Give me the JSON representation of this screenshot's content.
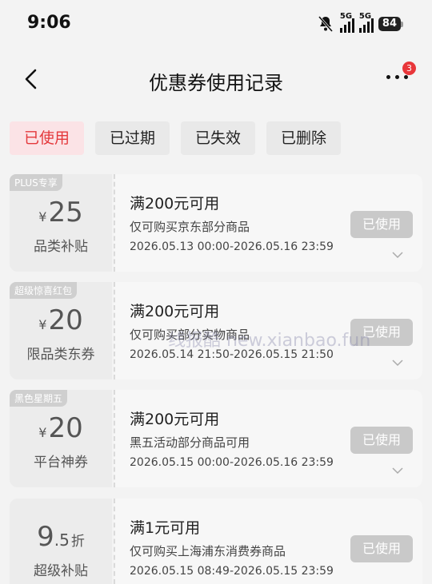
{
  "status_bar": {
    "time": "9:06",
    "signal_1_label": "5G",
    "signal_2_label": "5G",
    "battery": "84"
  },
  "header": {
    "title": "优惠券使用记录",
    "more_badge": "3"
  },
  "tabs": [
    {
      "label": "已使用",
      "active": true
    },
    {
      "label": "已过期",
      "active": false
    },
    {
      "label": "已失效",
      "active": false
    },
    {
      "label": "已删除",
      "active": false
    }
  ],
  "coupons": [
    {
      "corner_tag": "PLUS专享",
      "currency": "¥",
      "amount": "25",
      "category": "品类补贴",
      "condition": "满200元可用",
      "description": "仅可购买京东部分商品",
      "valid_period": "2026.05.13 00:00-2026.05.16 23:59",
      "status_label": "已使用"
    },
    {
      "corner_tag": "超级惊喜红包",
      "currency": "¥",
      "amount": "20",
      "category": "限品类东券",
      "condition": "满200元可用",
      "description": "仅可购买部分实物商品",
      "valid_period": "2026.05.14 21:50-2026.05.15 21:50",
      "status_label": "已使用"
    },
    {
      "corner_tag": "黑色星期五",
      "currency": "¥",
      "amount": "20",
      "category": "平台神券",
      "condition": "满200元可用",
      "description": "黑五活动部分商品可用",
      "valid_period": "2026.05.15 00:00-2026.05.16 23:59",
      "status_label": "已使用"
    },
    {
      "corner_tag": "",
      "amount_int": "9",
      "amount_dec": ".5",
      "amount_unit": "折",
      "category": "超级补贴",
      "condition": "满1元可用",
      "description": "仅可购买上海浦东消费券商品",
      "valid_period": "2026.05.15 08:49-2026.05.15 23:59",
      "status_label": "已使用"
    }
  ],
  "watermark": "线报酷 new.xianbao.fun",
  "colors": {
    "accent": "#e4393c",
    "active_tab_bg": "#fbe3e6",
    "used_button": "#c9c9c9"
  }
}
